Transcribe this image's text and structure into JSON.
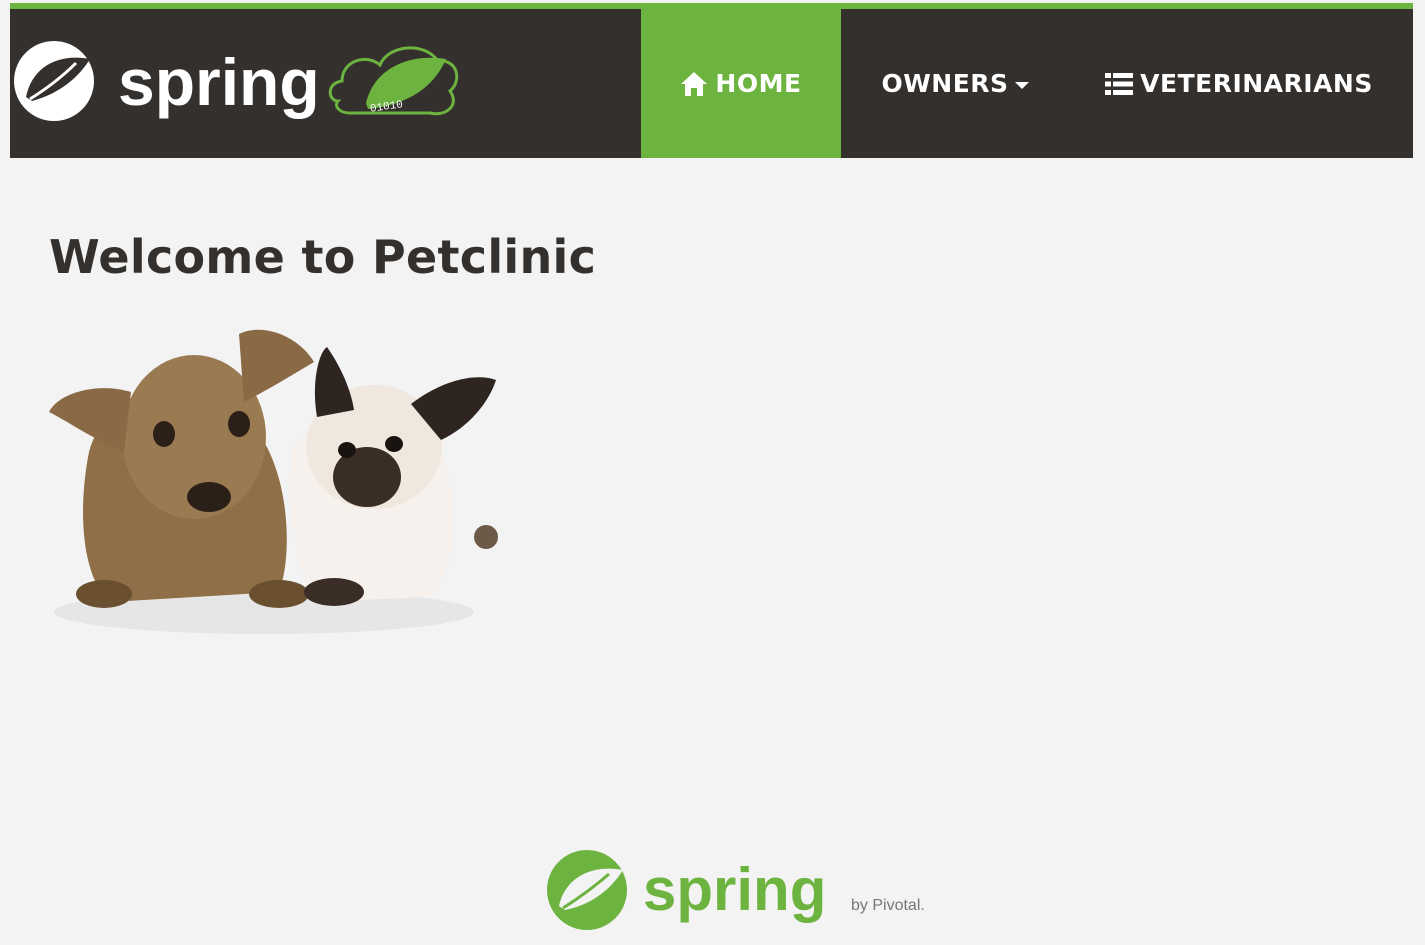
{
  "navbar": {
    "brand": {
      "wordmark": "spring",
      "badge_text": "01010"
    },
    "items": [
      {
        "label": "HOME",
        "icon": "home-icon",
        "active": true
      },
      {
        "label": "OWNERS",
        "icon": "caret-down-icon",
        "active": false,
        "dropdown": true
      },
      {
        "label": "VETERINARIANS",
        "icon": "list-icon",
        "active": false
      }
    ]
  },
  "main": {
    "title": "Welcome to Petclinic"
  },
  "footer": {
    "wordmark": "spring",
    "tagline": "by Pivotal."
  },
  "colors": {
    "brand_green": "#6db33f",
    "navbar_background": "#34302d",
    "page_background": "#f3f3f3",
    "heading_text": "#34302d"
  }
}
